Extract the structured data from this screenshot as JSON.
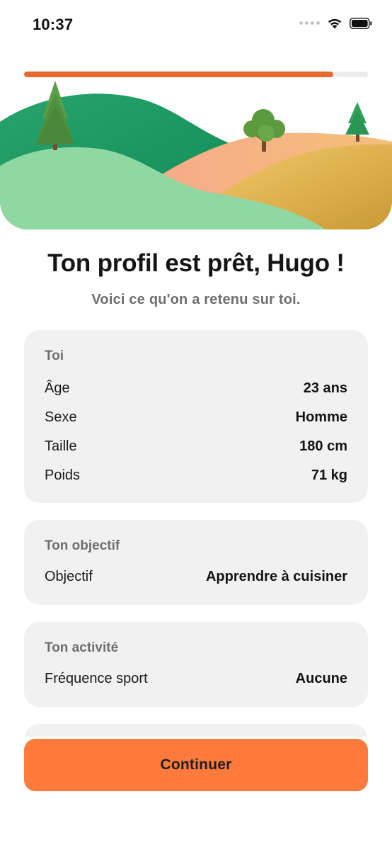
{
  "status_bar": {
    "time": "10:37",
    "icons": [
      "signal-dots-icon",
      "wifi-icon",
      "battery-icon"
    ]
  },
  "progress": {
    "value": 0.9,
    "color": "#e8692f"
  },
  "illustration": {
    "icon": "hills-landscape-illustration"
  },
  "header": {
    "title": "Ton profil est prêt, Hugo !",
    "subtitle": "Voici ce qu'on a retenu sur toi."
  },
  "sections": {
    "toi": {
      "title": "Toi",
      "rows": [
        {
          "label": "Âge",
          "value": "23 ans"
        },
        {
          "label": "Sexe",
          "value": "Homme"
        },
        {
          "label": "Taille",
          "value": "180 cm"
        },
        {
          "label": "Poids",
          "value": "71 kg"
        }
      ]
    },
    "objectif": {
      "title": "Ton objectif",
      "rows": [
        {
          "label": "Objectif",
          "value": "Apprendre à cuisiner"
        }
      ]
    },
    "activite": {
      "title": "Ton activité",
      "rows": [
        {
          "label": "Fréquence sport",
          "value": "Aucune"
        }
      ]
    }
  },
  "footer": {
    "continue_label": "Continuer",
    "button_color": "#ff7b3d"
  }
}
